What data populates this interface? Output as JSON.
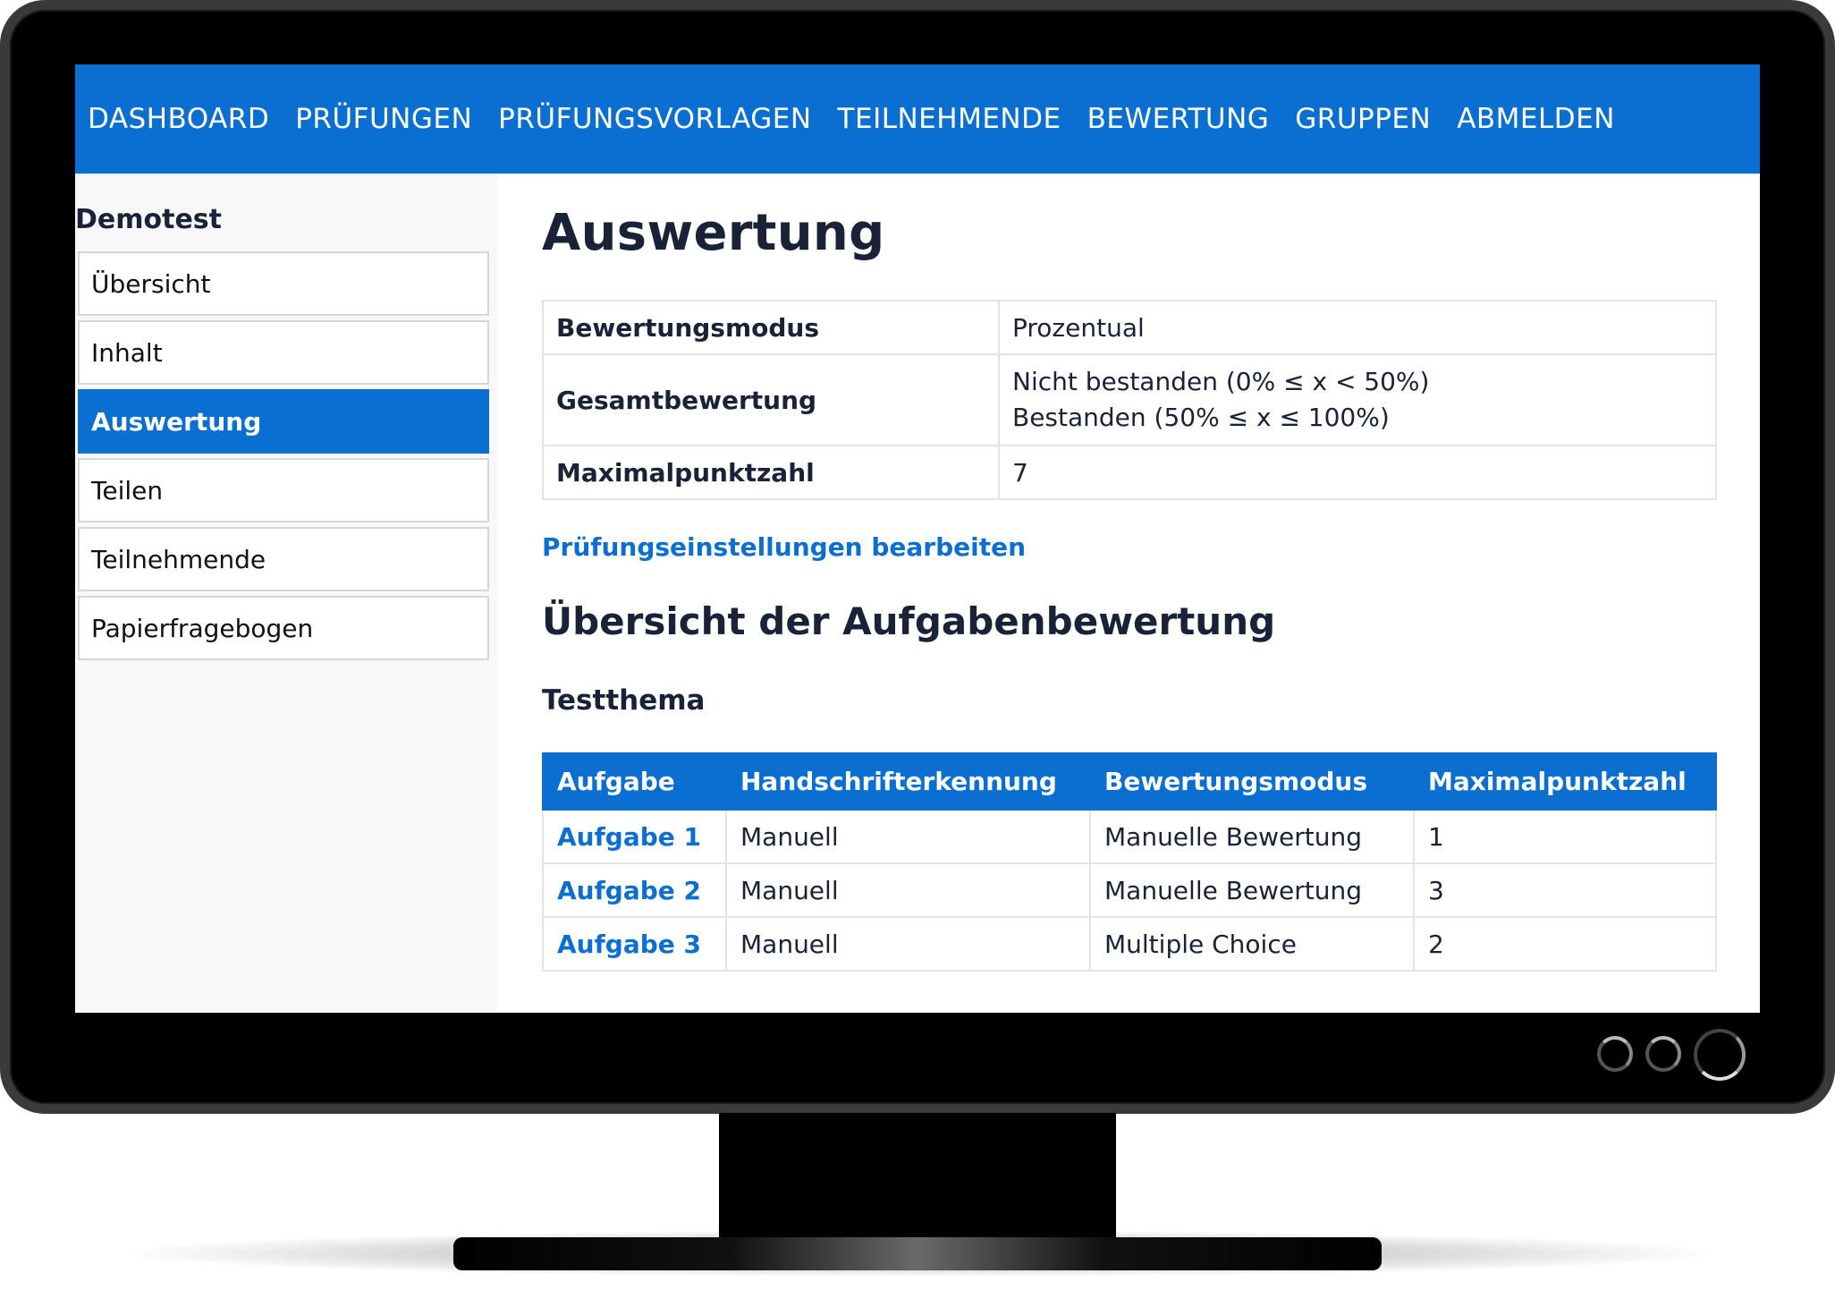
{
  "nav": {
    "items": [
      "DASHBOARD",
      "PRÜFUNGEN",
      "PRÜFUNGSVORLAGEN",
      "TEILNEHMENDE",
      "BEWERTUNG",
      "GRUPPEN",
      "ABMELDEN"
    ]
  },
  "sidebar": {
    "title": "Demotest",
    "items": [
      {
        "label": "Übersicht"
      },
      {
        "label": "Inhalt"
      },
      {
        "label": "Auswertung",
        "active": true
      },
      {
        "label": "Teilen"
      },
      {
        "label": "Teilnehmende"
      },
      {
        "label": "Papierfragebogen"
      }
    ]
  },
  "main": {
    "title": "Auswertung",
    "info": {
      "mode_label": "Bewertungsmodus",
      "mode_value": "Prozentual",
      "overall_label": "Gesamtbewertung",
      "overall_values": [
        "Nicht bestanden (0% ≤ x < 50%)",
        "Bestanden (50% ≤ x ≤ 100%)"
      ],
      "max_label": "Maximalpunktzahl",
      "max_value": "7"
    },
    "edit_link": "Prüfungseinstellungen bearbeiten",
    "section_title": "Übersicht der Aufgabenbewertung",
    "topic": "Testthema",
    "table": {
      "headers": [
        "Aufgabe",
        "Handschrifterkennung",
        "Bewertungsmodus",
        "Maximalpunktzahl"
      ],
      "rows": [
        [
          "Aufgabe 1",
          "Manuell",
          "Manuelle Bewertung",
          "1"
        ],
        [
          "Aufgabe 2",
          "Manuell",
          "Manuelle Bewertung",
          "3"
        ],
        [
          "Aufgabe 3",
          "Manuell",
          "Multiple Choice",
          "2"
        ]
      ]
    }
  },
  "colors": {
    "accent": "#0b6fd1",
    "text": "#1a2238",
    "sidebar_bg": "#f8f8f8"
  }
}
